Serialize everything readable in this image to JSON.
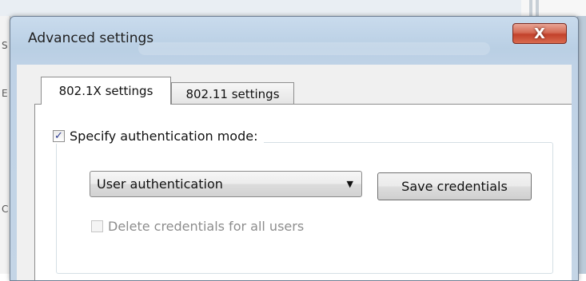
{
  "window": {
    "title": "Advanced settings",
    "close_glyph": "X"
  },
  "tabs": [
    {
      "label": "802.1X settings",
      "selected": true
    },
    {
      "label": "802.11 settings",
      "selected": false
    }
  ],
  "auth_mode": {
    "checkbox_checked": true,
    "checkbox_glyph": "✓",
    "label": "Specify authentication mode:",
    "dropdown_value": "User authentication",
    "save_button_label": "Save credentials"
  },
  "delete_credentials": {
    "label": "Delete credentials for all users",
    "checked": false,
    "enabled": false
  },
  "icons": {
    "close": "close-icon",
    "dropdown": "chevron-down-icon",
    "check": "checkmark-icon"
  }
}
